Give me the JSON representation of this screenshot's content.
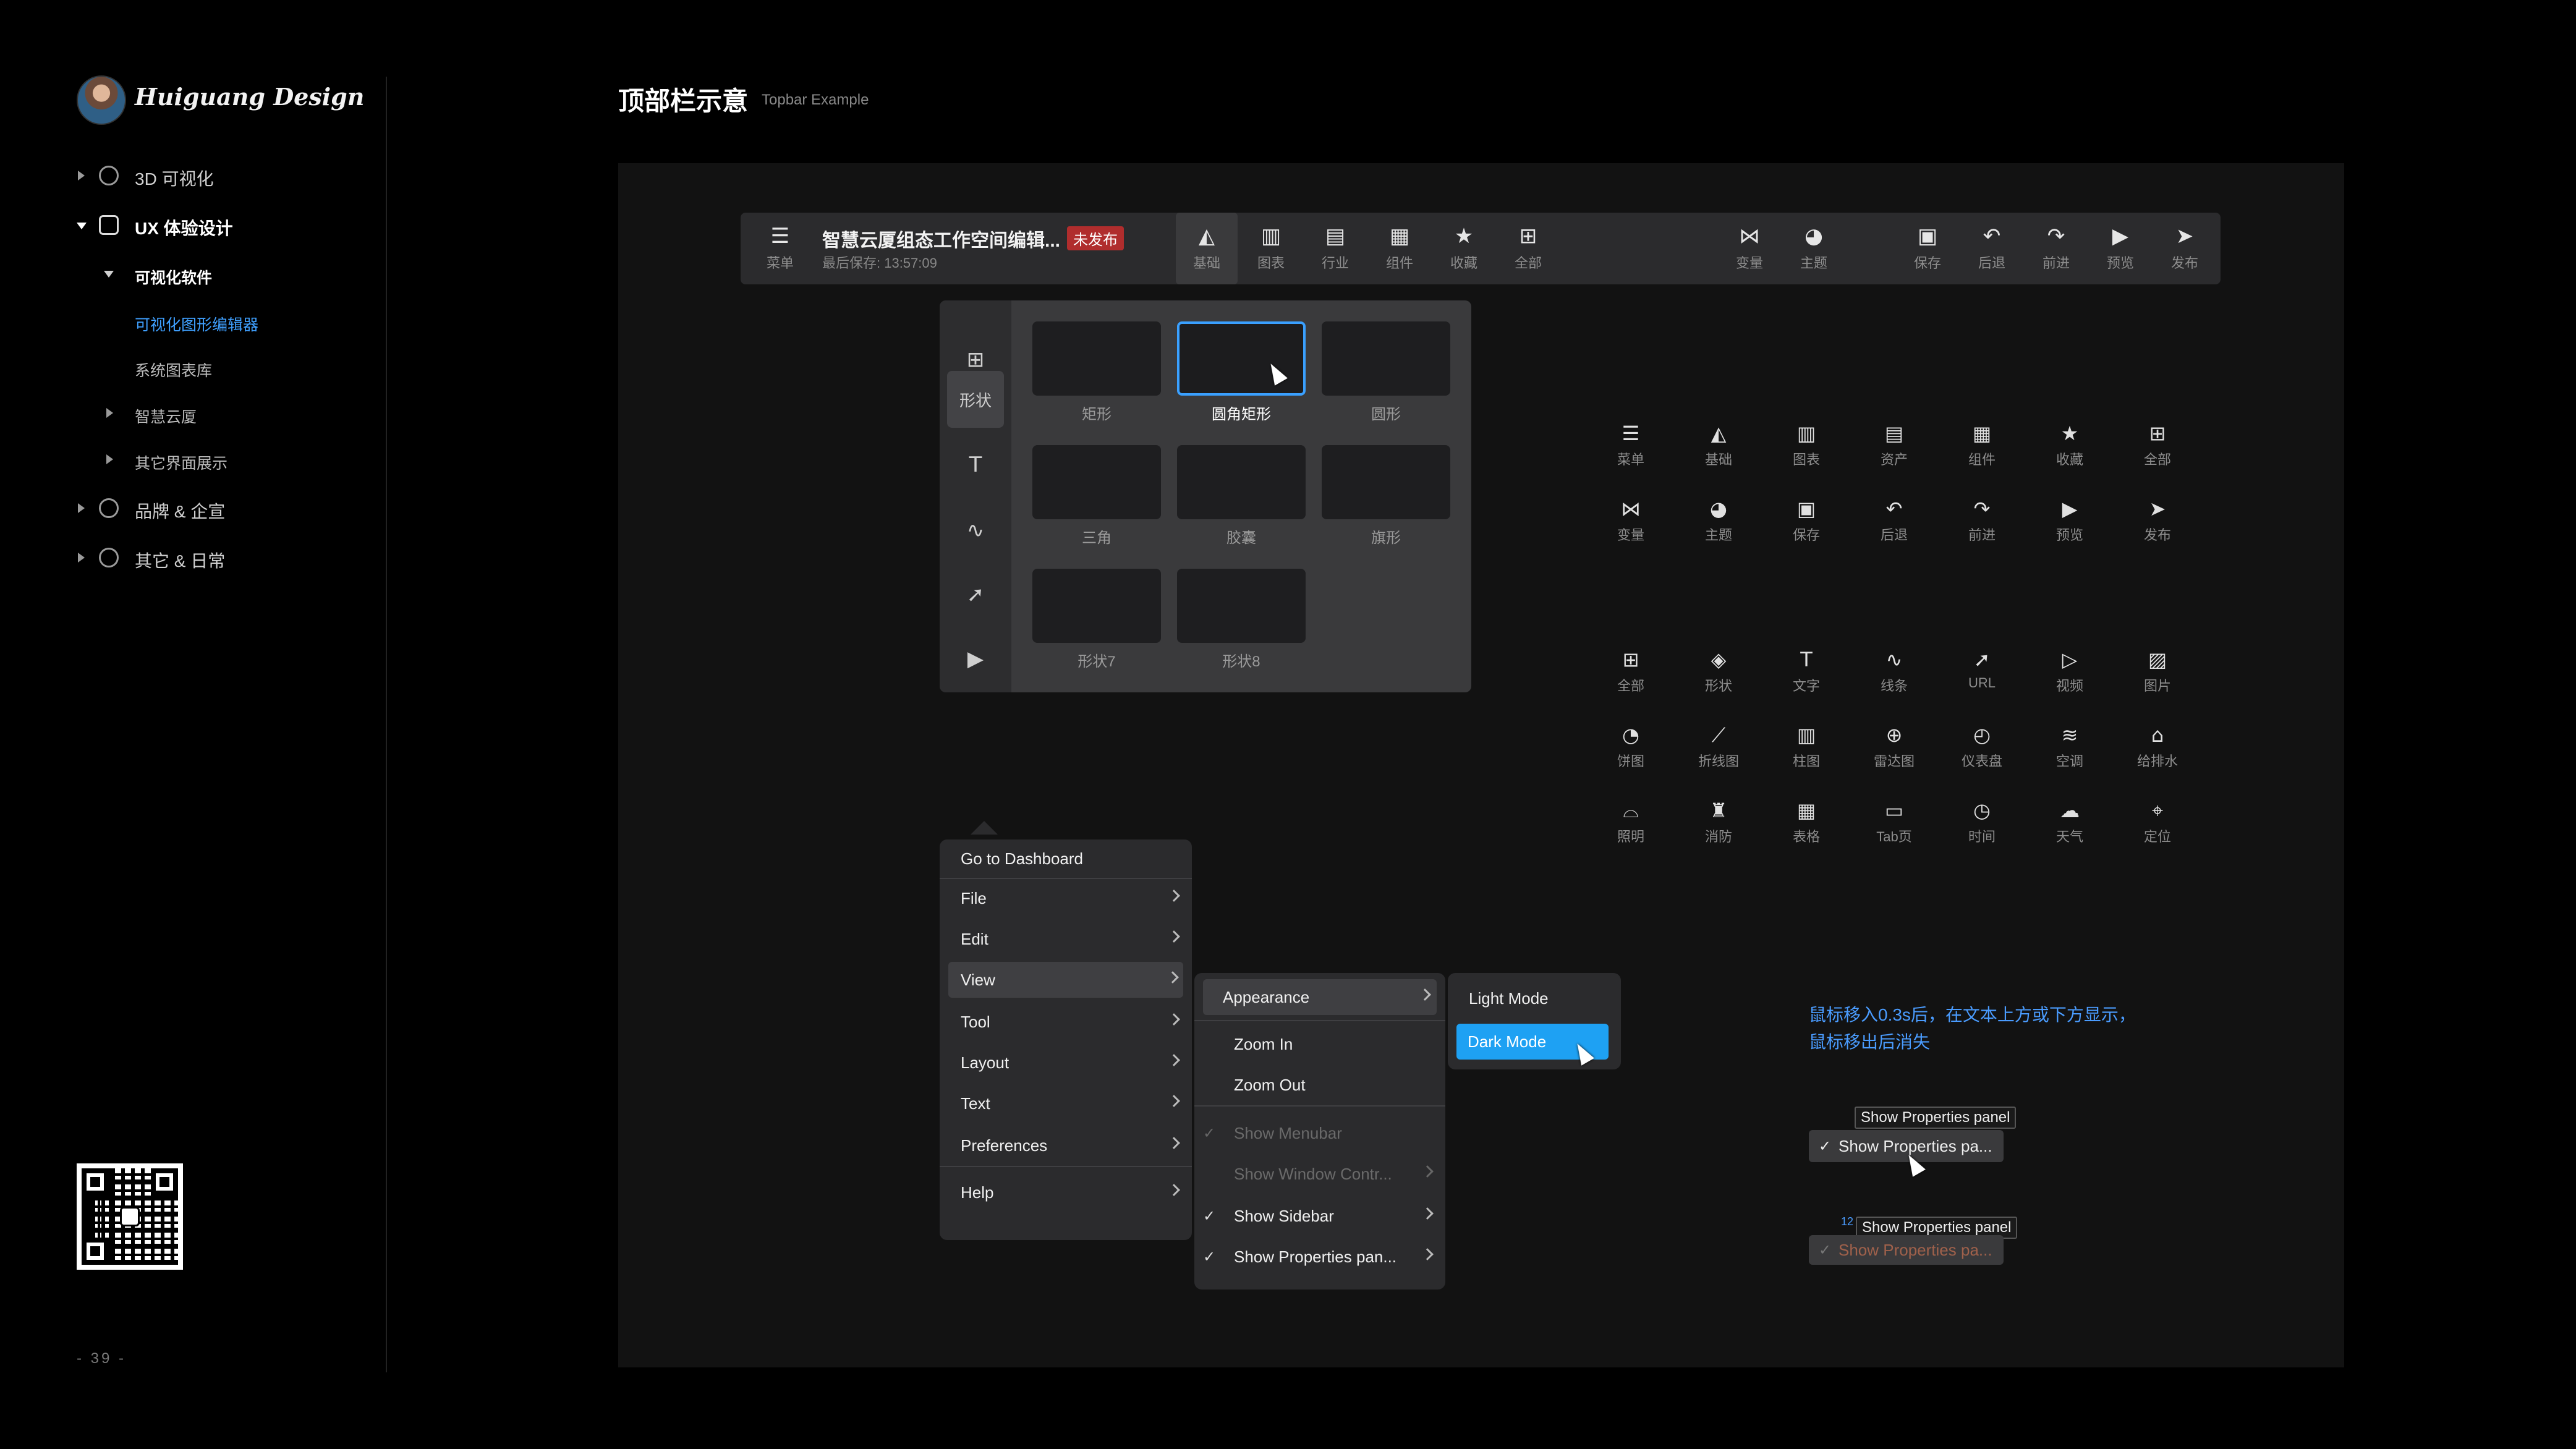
{
  "brand": {
    "name": "Huiguang Design"
  },
  "sidebar": {
    "items": [
      {
        "label": "3D 可视化"
      },
      {
        "label": "UX 体验设计"
      },
      {
        "label": "可视化软件"
      },
      {
        "label": "可视化图形编辑器"
      },
      {
        "label": "系统图表库"
      },
      {
        "label": "智慧云厦"
      },
      {
        "label": "其它界面展示"
      },
      {
        "label": "品牌 & 企宣"
      },
      {
        "label": "其它 & 日常"
      }
    ],
    "page_number": "- 39 -"
  },
  "header": {
    "title": "顶部栏示意",
    "subtitle": "Topbar Example"
  },
  "topbar": {
    "menu_label": "菜单",
    "doc_title": "智慧云厦组态工作空间编辑...",
    "status_badge": "未发布",
    "saved_text": "最后保存: 13:57:09",
    "center_buttons": [
      {
        "label": "基础",
        "icon": "shapes-icon"
      },
      {
        "label": "图表",
        "icon": "bar-chart-icon"
      },
      {
        "label": "行业",
        "icon": "folder-icon"
      },
      {
        "label": "组件",
        "icon": "table-icon"
      },
      {
        "label": "收藏",
        "icon": "star-icon"
      },
      {
        "label": "全部",
        "icon": "grid-icon"
      }
    ],
    "right_buttons": [
      {
        "label": "变量",
        "icon": "variable-icon"
      },
      {
        "label": "主题",
        "icon": "palette-icon"
      },
      {
        "label": "保存",
        "icon": "save-icon"
      },
      {
        "label": "后退",
        "icon": "undo-icon"
      },
      {
        "label": "前进",
        "icon": "redo-icon"
      },
      {
        "label": "预览",
        "icon": "preview-icon"
      },
      {
        "label": "发布",
        "icon": "send-icon"
      }
    ]
  },
  "shape_panel": {
    "rail_active_label": "形状",
    "tiles": [
      {
        "label": "矩形"
      },
      {
        "label": "圆角矩形"
      },
      {
        "label": "圆形"
      },
      {
        "label": "三角"
      },
      {
        "label": "胶囊"
      },
      {
        "label": "旗形"
      },
      {
        "label": "形状7"
      },
      {
        "label": "形状8"
      }
    ]
  },
  "icon_set_1": [
    {
      "label": "菜单",
      "icon": "menu-icon"
    },
    {
      "label": "基础",
      "icon": "shapes-icon"
    },
    {
      "label": "图表",
      "icon": "bar-chart-icon"
    },
    {
      "label": "资产",
      "icon": "folder-icon"
    },
    {
      "label": "组件",
      "icon": "table-icon"
    },
    {
      "label": "收藏",
      "icon": "star-icon"
    },
    {
      "label": "全部",
      "icon": "grid-icon"
    },
    {
      "label": "变量",
      "icon": "variable-icon"
    },
    {
      "label": "主题",
      "icon": "palette-icon"
    },
    {
      "label": "保存",
      "icon": "save-icon"
    },
    {
      "label": "后退",
      "icon": "undo-icon"
    },
    {
      "label": "前进",
      "icon": "redo-icon"
    },
    {
      "label": "预览",
      "icon": "preview-icon"
    },
    {
      "label": "发布",
      "icon": "send-icon"
    }
  ],
  "icon_set_2": [
    {
      "label": "全部",
      "icon": "grid-icon"
    },
    {
      "label": "形状",
      "icon": "shape-icon"
    },
    {
      "label": "文字",
      "icon": "text-icon"
    },
    {
      "label": "线条",
      "icon": "line-icon"
    },
    {
      "label": "URL",
      "icon": "cursor-icon"
    },
    {
      "label": "视频",
      "icon": "video-icon"
    },
    {
      "label": "图片",
      "icon": "image-icon"
    },
    {
      "label": "饼图",
      "icon": "pie-icon"
    },
    {
      "label": "折线图",
      "icon": "line-chart-icon"
    },
    {
      "label": "柱图",
      "icon": "bar-chart-icon"
    },
    {
      "label": "雷达图",
      "icon": "radar-icon"
    },
    {
      "label": "仪表盘",
      "icon": "gauge-icon"
    },
    {
      "label": "空调",
      "icon": "ac-icon"
    },
    {
      "label": "给排水",
      "icon": "water-icon"
    },
    {
      "label": "照明",
      "icon": "lamp-icon"
    },
    {
      "label": "消防",
      "icon": "fire-hydrant-icon"
    },
    {
      "label": "表格",
      "icon": "table-icon"
    },
    {
      "label": "Tab页",
      "icon": "tab-icon"
    },
    {
      "label": "时间",
      "icon": "clock-icon"
    },
    {
      "label": "天气",
      "icon": "weather-icon"
    },
    {
      "label": "定位",
      "icon": "location-icon"
    }
  ],
  "main_menu": {
    "items": [
      {
        "label": "Go to Dashboard"
      },
      {
        "label": "File"
      },
      {
        "label": "Edit"
      },
      {
        "label": "View"
      },
      {
        "label": "Tool"
      },
      {
        "label": "Layout"
      },
      {
        "label": "Text"
      },
      {
        "label": "Preferences"
      },
      {
        "label": "Help"
      }
    ]
  },
  "view_menu": {
    "items": [
      {
        "label": "Appearance"
      },
      {
        "label": "Zoom In"
      },
      {
        "label": "Zoom Out"
      },
      {
        "label": "Show Menubar"
      },
      {
        "label": "Show Window Contr..."
      },
      {
        "label": "Show Sidebar"
      },
      {
        "label": "Show Properties pan..."
      }
    ]
  },
  "appearance_menu": {
    "items": [
      {
        "label": "Light Mode"
      },
      {
        "label": "Dark Mode"
      }
    ]
  },
  "tooltip_demo": {
    "note_line1": "鼠标移入0.3s后，在文本上方或下方显示，",
    "note_line2": "鼠标移出后消失",
    "tooltip_text": "Show Properties panel",
    "chip_text": "Show Properties pa...",
    "tooltip_text_2": "Show Properties panel",
    "chip_text_2": "Show Properties pa...",
    "small_number": "12"
  },
  "colors": {
    "accent": "#3aa0ff",
    "badge": "#b02d2d",
    "highlight": "#1ea1f3",
    "background": "#000000"
  }
}
